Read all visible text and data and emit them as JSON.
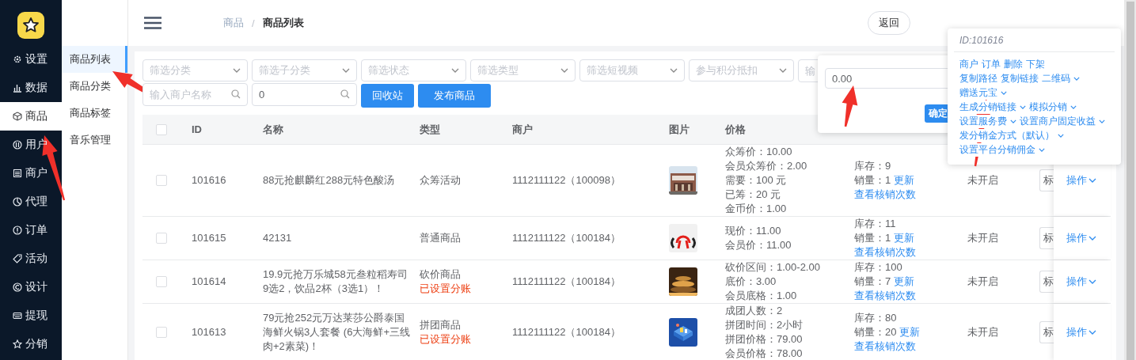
{
  "sidebar": {
    "items": [
      {
        "label": "设置",
        "selected": false
      },
      {
        "label": "数据",
        "selected": false
      },
      {
        "label": "商品",
        "selected": true
      },
      {
        "label": "用户",
        "selected": false
      },
      {
        "label": "商户",
        "selected": false
      },
      {
        "label": "代理",
        "selected": false
      },
      {
        "label": "订单",
        "selected": false
      },
      {
        "label": "活动",
        "selected": false
      },
      {
        "label": "设计",
        "selected": false
      },
      {
        "label": "提现",
        "selected": false
      },
      {
        "label": "分销",
        "selected": false
      }
    ]
  },
  "submenu": {
    "items": [
      {
        "label": "商品列表",
        "selected": true
      },
      {
        "label": "商品分类",
        "selected": false
      },
      {
        "label": "商品标签",
        "selected": false
      },
      {
        "label": "音乐管理",
        "selected": false
      }
    ]
  },
  "header": {
    "breadcrumb": [
      "商品",
      "商品列表"
    ],
    "separator": "/",
    "back_button": "返回"
  },
  "filters": {
    "selects": [
      "筛选分类",
      "筛选子分类",
      "筛选状态",
      "筛选类型",
      "筛选短视频",
      "参与积分抵扣"
    ],
    "input": {
      "placeholder": "输"
    },
    "search_fields": [
      {
        "placeholder": "输入商户名称"
      },
      {
        "value": "0"
      }
    ],
    "buttons": [
      "回收站",
      "发布商品"
    ]
  },
  "table": {
    "header_checked": false,
    "columns": [
      "ID",
      "名称",
      "类型",
      "商户",
      "图片",
      "价格"
    ],
    "rows": [
      {
        "checked": false,
        "id": "101616",
        "name": "88元抢麒麟红288元特色酸汤",
        "type": "众筹活动",
        "merchant": "1112111122（100098）",
        "image": {
          "kind": "picture"
        },
        "price_lines": [
          "众筹价：10.00",
          "会员众筹价：2.00",
          "需要：100 元",
          "已筹：20 元",
          "金币价：1.00"
        ],
        "stock": "库存：9",
        "sales": "销量：1",
        "update_link": "更新",
        "verify_link": "查看核销次数",
        "status": "未开启",
        "tag_button": "标",
        "action": "操作"
      },
      {
        "checked": false,
        "id": "101615",
        "name": "42131",
        "type": "普通商品",
        "merchant": "1112111122（100184）",
        "image": {
          "kind": "picture"
        },
        "price_lines": [
          "现价：11.00",
          "会员价：11.00"
        ],
        "stock": "库存：11",
        "sales": "销量：1",
        "update_link": "更新",
        "verify_link": "查看核销次数",
        "status": "未开启",
        "tag_button": "标",
        "action": "操作"
      },
      {
        "checked": false,
        "id": "101614",
        "name": "19.9元抢万乐城58元叁粒稻寿司9选2，饮品2杯（3选1）！",
        "type": "砍价商品",
        "split_tag": "已设置分账",
        "merchant": "1112111122（100184）",
        "image": {
          "kind": "picture"
        },
        "price_lines": [
          "砍价区间：1.00-2.00",
          "底价：3.00",
          "会员底格：1.00"
        ],
        "stock": "库存：100",
        "sales": "销量：7",
        "update_link": "更新",
        "verify_link": "查看核销次数",
        "status": "未开启",
        "tag_button": "标",
        "action": "操作"
      },
      {
        "checked": false,
        "id": "101613",
        "name": "79元抢252元万达莱莎公爵泰国海鲜火锅3人套餐 (6大海鲜+三线肉+2素菜)！",
        "type": "拼团商品",
        "split_tag": "已设置分账",
        "merchant": "1112111122（100184）",
        "image": {
          "kind": "picture"
        },
        "price_lines": [
          "成团人数：2",
          "拼团时间：2小时",
          "拼团价格：79.00",
          "会员价格：78.00"
        ],
        "stock": "库存：80",
        "sales": "销量：20",
        "update_link": "更新",
        "verify_link": "查看核销次数",
        "status": "未开启",
        "tag_button": "标",
        "action": "操作"
      }
    ]
  },
  "amount_popover": {
    "value": "0.00",
    "button": "确定"
  },
  "action_menu": {
    "title": "ID:101616",
    "lines": [
      [
        {
          "label": "商户",
          "dropdown": false
        },
        {
          "label": "订单",
          "dropdown": false
        },
        {
          "label": "删除",
          "dropdown": false
        },
        {
          "label": "下架",
          "dropdown": false
        }
      ],
      [
        {
          "label": "复制路径",
          "dropdown": false
        },
        {
          "label": "复制链接",
          "dropdown": false
        },
        {
          "label": "二维码",
          "dropdown": true
        }
      ],
      [
        {
          "label": "赠送元宝",
          "dropdown": true
        }
      ],
      [
        {
          "label": "生成分销链接",
          "dropdown": true
        },
        {
          "label": "模拟分销",
          "dropdown": true
        }
      ],
      [
        {
          "label": "设置服务费",
          "dropdown": true
        },
        {
          "label": "设置商户固定收益",
          "dropdown": true
        }
      ],
      [
        {
          "label": "发分销金方式（默认）",
          "dropdown": true
        }
      ],
      [
        {
          "label": "设置平台分销佣金",
          "dropdown": true
        }
      ]
    ]
  },
  "annotations": [
    {
      "kind": "arrow"
    },
    {
      "kind": "arrow"
    },
    {
      "kind": "arrow"
    },
    {
      "kind": "arrow"
    }
  ]
}
